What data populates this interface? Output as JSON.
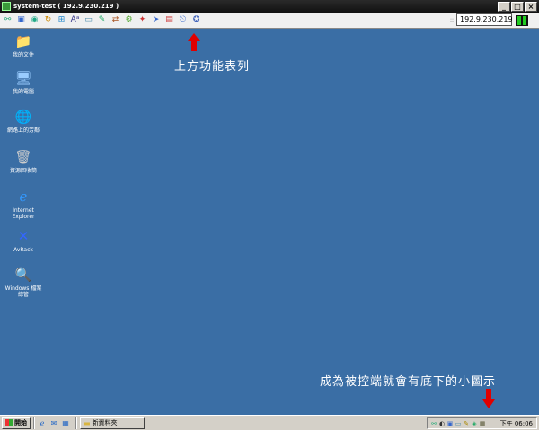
{
  "window": {
    "title": "system-test ( 192.9.230.219 )",
    "minimize": "_",
    "maximize": "□",
    "close": "×"
  },
  "toolbar": {
    "buttons": [
      {
        "name": "connect-icon",
        "glyph": "⚯",
        "color": "#2a7"
      },
      {
        "name": "display-icon",
        "glyph": "▣",
        "color": "#36c"
      },
      {
        "name": "globe-icon",
        "glyph": "◉",
        "color": "#2a8"
      },
      {
        "name": "refresh-icon",
        "glyph": "↻",
        "color": "#c80"
      },
      {
        "name": "network-icon",
        "glyph": "⊞",
        "color": "#28c"
      },
      {
        "name": "text-icon",
        "glyph": "Aᵃ",
        "color": "#338"
      },
      {
        "name": "monitor-icon",
        "glyph": "▭",
        "color": "#48a"
      },
      {
        "name": "chat-icon",
        "glyph": "✎",
        "color": "#2a6"
      },
      {
        "name": "transfer-icon",
        "glyph": "⇄",
        "color": "#a52"
      },
      {
        "name": "tools-icon",
        "glyph": "⚙",
        "color": "#5a3"
      },
      {
        "name": "settings-icon",
        "glyph": "✦",
        "color": "#c33"
      },
      {
        "name": "send-icon",
        "glyph": "➤",
        "color": "#36c"
      },
      {
        "name": "capture-icon",
        "glyph": "▤",
        "color": "#c33"
      },
      {
        "name": "logout-icon",
        "glyph": "⎋",
        "color": "#36c"
      },
      {
        "name": "help-icon",
        "glyph": "✪",
        "color": "#46b"
      }
    ],
    "ip_value": "192.9.230.219",
    "ip_dots": "::"
  },
  "desktop": {
    "icons": [
      {
        "name": "my-documents-icon",
        "label": "我的文件",
        "glyph": "📁",
        "color": "#f0d060"
      },
      {
        "name": "my-computer-icon",
        "label": "我的電腦",
        "glyph": "🖥",
        "color": "#9cf"
      },
      {
        "name": "network-places-icon",
        "label": "網路上的芳鄰",
        "glyph": "🌐",
        "color": "#3c9"
      },
      {
        "name": "recycle-bin-icon",
        "label": "資源回收筒",
        "glyph": "🗑",
        "color": "#ccc"
      },
      {
        "name": "internet-explorer-icon",
        "label": "Internet Explorer",
        "glyph": "ℯ",
        "color": "#39f"
      },
      {
        "name": "avrack-icon",
        "label": "AvRack",
        "glyph": "✕",
        "color": "#36f"
      },
      {
        "name": "windows-explorer-icon",
        "label": "Windows 檔案總管",
        "glyph": "🔍",
        "color": "#fc6"
      }
    ]
  },
  "annotations": {
    "top": "上方功能表列",
    "bottom": "成為被控端就會有底下的小圖示",
    "arrow_color": "#e00000"
  },
  "taskbar": {
    "start_label": "開始",
    "quick_launch": [
      {
        "name": "ie-quicklaunch-icon",
        "glyph": "ℯ"
      },
      {
        "name": "outlook-quicklaunch-icon",
        "glyph": "✉"
      },
      {
        "name": "desktop-quicklaunch-icon",
        "glyph": "▦"
      }
    ],
    "task_label": "新資料夾",
    "tray_icons": [
      {
        "name": "tray-network-icon",
        "glyph": "⚯"
      },
      {
        "name": "tray-volume-icon",
        "glyph": "◐"
      },
      {
        "name": "tray-remote-icon",
        "glyph": "▣"
      },
      {
        "name": "tray-monitor-icon",
        "glyph": "▭"
      },
      {
        "name": "tray-pen-icon",
        "glyph": "✎"
      },
      {
        "name": "tray-shield-icon",
        "glyph": "◈"
      },
      {
        "name": "tray-controlled-icon",
        "glyph": "▦"
      }
    ],
    "clock": "下午 06:06"
  }
}
